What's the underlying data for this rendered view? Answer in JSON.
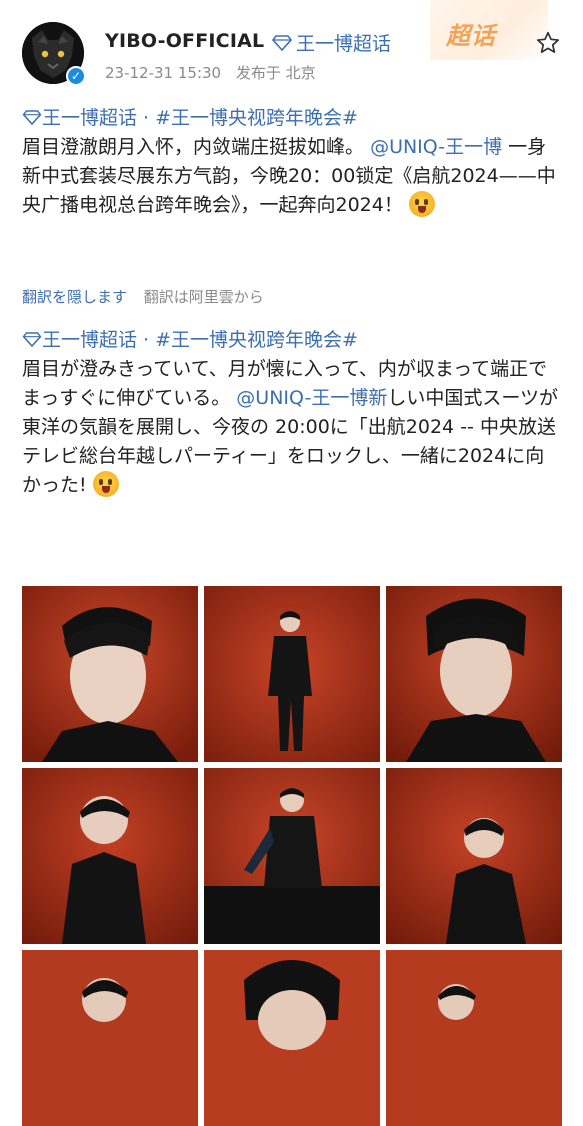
{
  "post": {
    "author": "YIBO-OFFICIAL",
    "topic_chip": "王一博超话",
    "timestamp": "23-12-31 15:30",
    "posted_from": "发布于 北京",
    "super_topic_badge": "超话"
  },
  "original": {
    "topic_tag": "王一博超话",
    "separator": " · ",
    "hashtag": "#王一博央视跨年晚会#",
    "text_before_mention": "眉目澄澈朗月入怀，内敛端庄挺拔如峰。",
    "mention": "@UNIQ-王一博",
    "text_after_mention": " 一身新中式套装尽展东方气韵，今晚20：00锁定《启航2024——中央广播电视总台跨年晚会》，一起奔向2024！"
  },
  "translation_bar": {
    "hide_translation": "翻訳を隠します",
    "translated_by": "翻訳は阿里雲から"
  },
  "translated": {
    "topic_tag": "王一博超话",
    "separator": " · ",
    "hashtag": "#王一博央视跨年晚会#",
    "text_before_mention": "眉目が澄みきっていて、月が懐に入って、内が収まって端正でまっすぐに伸びている。",
    "mention": "@UNIQ-王一博新",
    "text_after_mention": "しい中国式スーツが東洋の気韻を展開し、今夜の 20:00に「出航2024 -- 中央放送テレビ総台年越しパーティー」をロックし、一緒に2024に向かった!"
  },
  "icons": {
    "verified": "verified-badge-icon",
    "diamond": "diamond-icon",
    "star": "star-outline-icon",
    "emoji": "screaming-face-emoji"
  },
  "colors": {
    "link": "#3d6fb0",
    "meta": "#8a8a8a",
    "badge": "#f3a25a",
    "photo_backdrop": "#b8391c"
  }
}
